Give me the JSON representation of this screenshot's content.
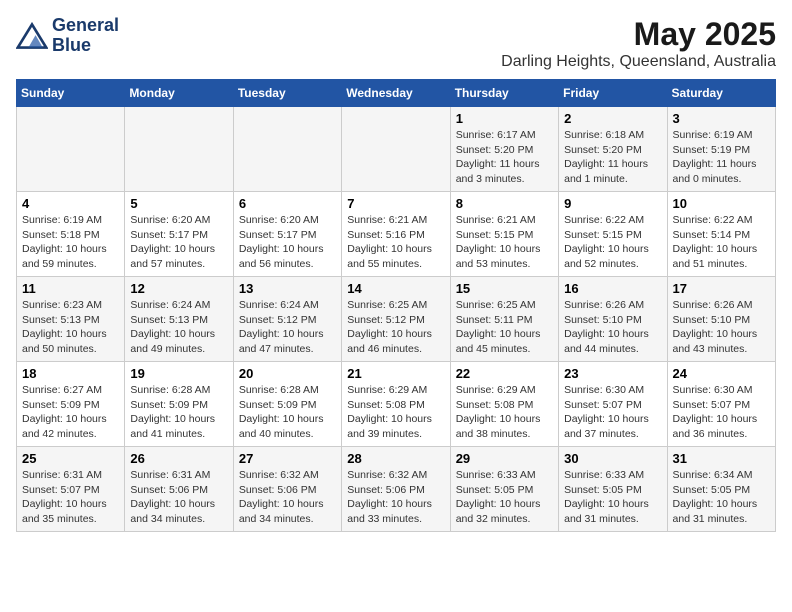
{
  "header": {
    "logo_line1": "General",
    "logo_line2": "Blue",
    "title": "May 2025",
    "subtitle": "Darling Heights, Queensland, Australia"
  },
  "days_of_week": [
    "Sunday",
    "Monday",
    "Tuesday",
    "Wednesday",
    "Thursday",
    "Friday",
    "Saturday"
  ],
  "weeks": [
    [
      {
        "day": "",
        "info": ""
      },
      {
        "day": "",
        "info": ""
      },
      {
        "day": "",
        "info": ""
      },
      {
        "day": "",
        "info": ""
      },
      {
        "day": "1",
        "info": "Sunrise: 6:17 AM\nSunset: 5:20 PM\nDaylight: 11 hours\nand 3 minutes."
      },
      {
        "day": "2",
        "info": "Sunrise: 6:18 AM\nSunset: 5:20 PM\nDaylight: 11 hours\nand 1 minute."
      },
      {
        "day": "3",
        "info": "Sunrise: 6:19 AM\nSunset: 5:19 PM\nDaylight: 11 hours\nand 0 minutes."
      }
    ],
    [
      {
        "day": "4",
        "info": "Sunrise: 6:19 AM\nSunset: 5:18 PM\nDaylight: 10 hours\nand 59 minutes."
      },
      {
        "day": "5",
        "info": "Sunrise: 6:20 AM\nSunset: 5:17 PM\nDaylight: 10 hours\nand 57 minutes."
      },
      {
        "day": "6",
        "info": "Sunrise: 6:20 AM\nSunset: 5:17 PM\nDaylight: 10 hours\nand 56 minutes."
      },
      {
        "day": "7",
        "info": "Sunrise: 6:21 AM\nSunset: 5:16 PM\nDaylight: 10 hours\nand 55 minutes."
      },
      {
        "day": "8",
        "info": "Sunrise: 6:21 AM\nSunset: 5:15 PM\nDaylight: 10 hours\nand 53 minutes."
      },
      {
        "day": "9",
        "info": "Sunrise: 6:22 AM\nSunset: 5:15 PM\nDaylight: 10 hours\nand 52 minutes."
      },
      {
        "day": "10",
        "info": "Sunrise: 6:22 AM\nSunset: 5:14 PM\nDaylight: 10 hours\nand 51 minutes."
      }
    ],
    [
      {
        "day": "11",
        "info": "Sunrise: 6:23 AM\nSunset: 5:13 PM\nDaylight: 10 hours\nand 50 minutes."
      },
      {
        "day": "12",
        "info": "Sunrise: 6:24 AM\nSunset: 5:13 PM\nDaylight: 10 hours\nand 49 minutes."
      },
      {
        "day": "13",
        "info": "Sunrise: 6:24 AM\nSunset: 5:12 PM\nDaylight: 10 hours\nand 47 minutes."
      },
      {
        "day": "14",
        "info": "Sunrise: 6:25 AM\nSunset: 5:12 PM\nDaylight: 10 hours\nand 46 minutes."
      },
      {
        "day": "15",
        "info": "Sunrise: 6:25 AM\nSunset: 5:11 PM\nDaylight: 10 hours\nand 45 minutes."
      },
      {
        "day": "16",
        "info": "Sunrise: 6:26 AM\nSunset: 5:10 PM\nDaylight: 10 hours\nand 44 minutes."
      },
      {
        "day": "17",
        "info": "Sunrise: 6:26 AM\nSunset: 5:10 PM\nDaylight: 10 hours\nand 43 minutes."
      }
    ],
    [
      {
        "day": "18",
        "info": "Sunrise: 6:27 AM\nSunset: 5:09 PM\nDaylight: 10 hours\nand 42 minutes."
      },
      {
        "day": "19",
        "info": "Sunrise: 6:28 AM\nSunset: 5:09 PM\nDaylight: 10 hours\nand 41 minutes."
      },
      {
        "day": "20",
        "info": "Sunrise: 6:28 AM\nSunset: 5:09 PM\nDaylight: 10 hours\nand 40 minutes."
      },
      {
        "day": "21",
        "info": "Sunrise: 6:29 AM\nSunset: 5:08 PM\nDaylight: 10 hours\nand 39 minutes."
      },
      {
        "day": "22",
        "info": "Sunrise: 6:29 AM\nSunset: 5:08 PM\nDaylight: 10 hours\nand 38 minutes."
      },
      {
        "day": "23",
        "info": "Sunrise: 6:30 AM\nSunset: 5:07 PM\nDaylight: 10 hours\nand 37 minutes."
      },
      {
        "day": "24",
        "info": "Sunrise: 6:30 AM\nSunset: 5:07 PM\nDaylight: 10 hours\nand 36 minutes."
      }
    ],
    [
      {
        "day": "25",
        "info": "Sunrise: 6:31 AM\nSunset: 5:07 PM\nDaylight: 10 hours\nand 35 minutes."
      },
      {
        "day": "26",
        "info": "Sunrise: 6:31 AM\nSunset: 5:06 PM\nDaylight: 10 hours\nand 34 minutes."
      },
      {
        "day": "27",
        "info": "Sunrise: 6:32 AM\nSunset: 5:06 PM\nDaylight: 10 hours\nand 34 minutes."
      },
      {
        "day": "28",
        "info": "Sunrise: 6:32 AM\nSunset: 5:06 PM\nDaylight: 10 hours\nand 33 minutes."
      },
      {
        "day": "29",
        "info": "Sunrise: 6:33 AM\nSunset: 5:05 PM\nDaylight: 10 hours\nand 32 minutes."
      },
      {
        "day": "30",
        "info": "Sunrise: 6:33 AM\nSunset: 5:05 PM\nDaylight: 10 hours\nand 31 minutes."
      },
      {
        "day": "31",
        "info": "Sunrise: 6:34 AM\nSunset: 5:05 PM\nDaylight: 10 hours\nand 31 minutes."
      }
    ]
  ]
}
